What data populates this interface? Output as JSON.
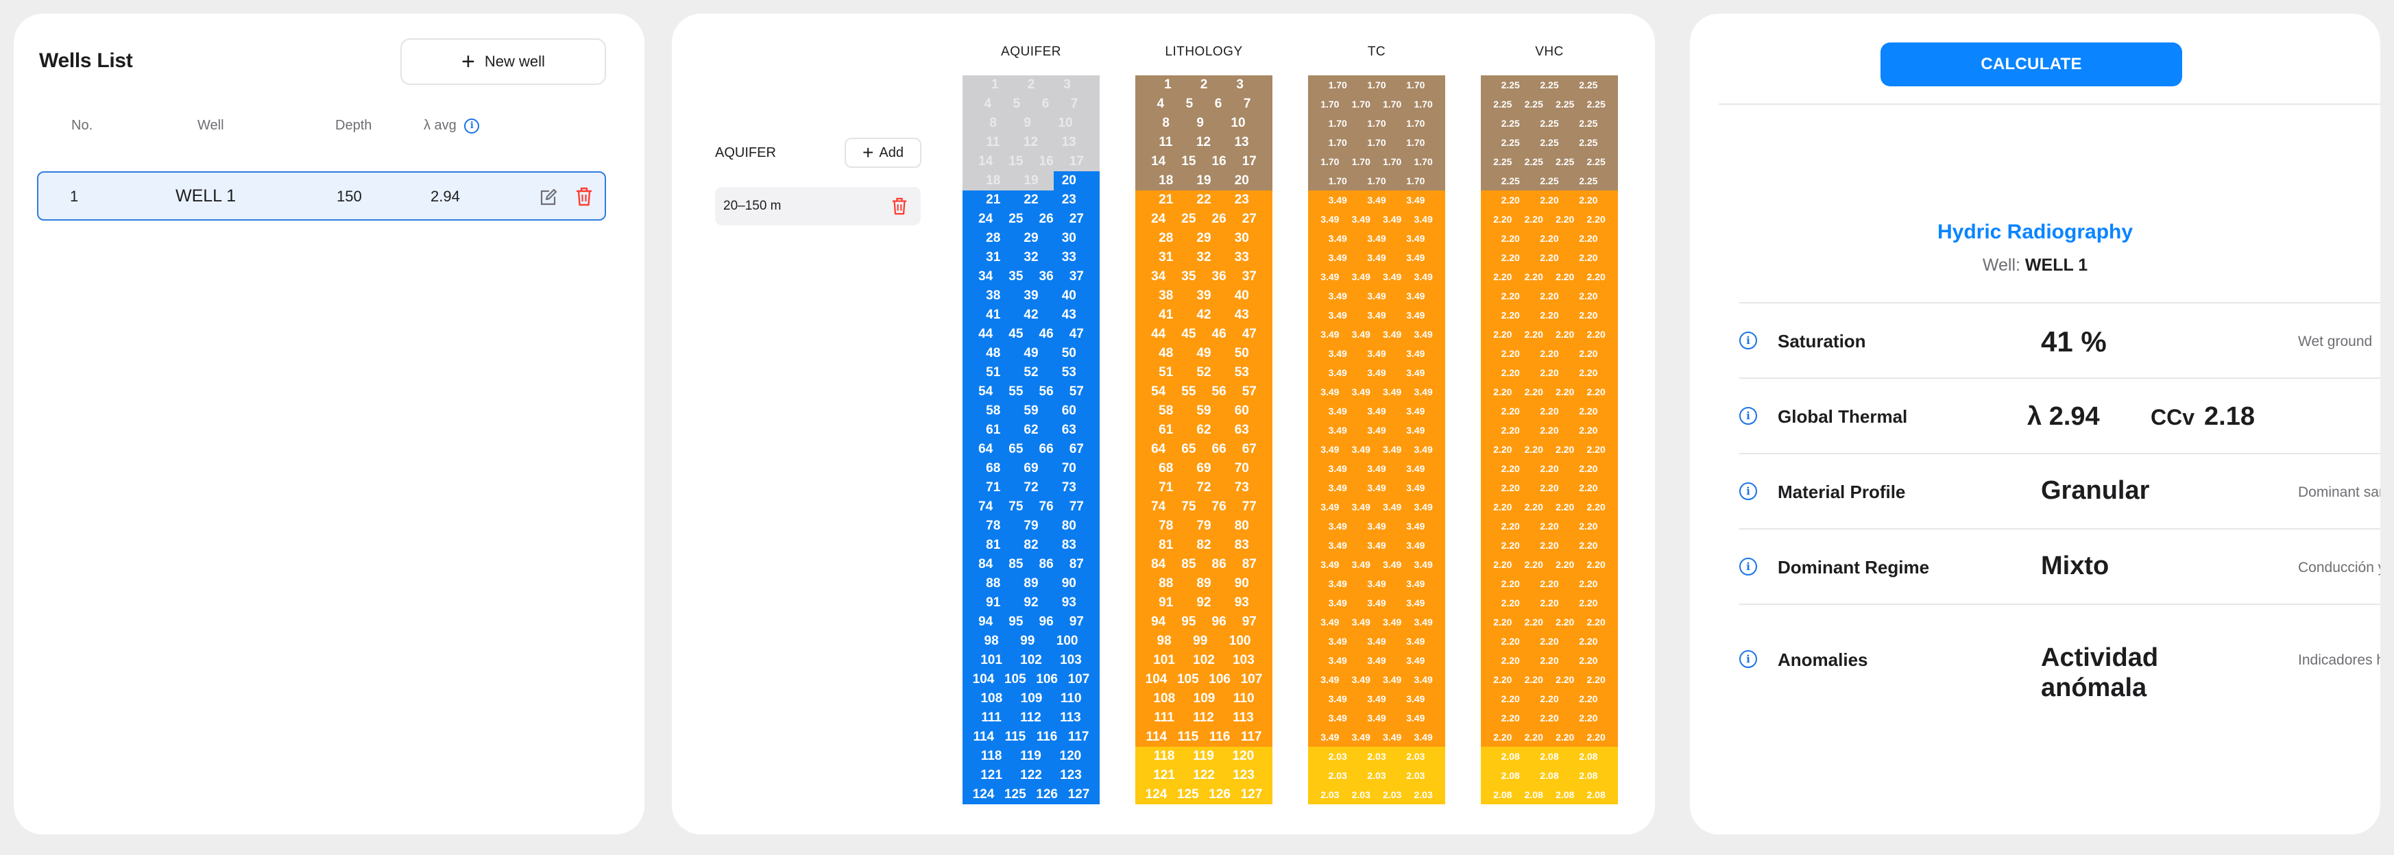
{
  "wells_list": {
    "title": "Wells List",
    "new_well_label": "New well",
    "columns": {
      "no": "No.",
      "well": "Well",
      "depth": "Depth",
      "lambda_avg": "λ avg"
    },
    "rows": [
      {
        "no": "1",
        "well": "WELL 1",
        "depth": "150",
        "lambda_avg": "2.94"
      }
    ]
  },
  "aquifer_editor": {
    "label": "AQUIFER",
    "add_label": "Add",
    "ranges": [
      "20–150 m"
    ]
  },
  "columns": {
    "aquifer": "AQUIFER",
    "lithology": "LITHOLOGY",
    "tc": "TC",
    "vhc": "VHC"
  },
  "colors": {
    "aquifer_blue": "#0a7cf0",
    "inactive_gray": "#cfcfd2",
    "lithology_brown": "#a88865",
    "lithology_orange": "#ff9a0d",
    "lithology_yellow": "#ffc90f",
    "accent": "#0a84ff",
    "danger": "#ff3b30"
  },
  "result": {
    "calculate_label": "CALCULATE",
    "title": "Hydric Radiography",
    "well_label": "Well:",
    "well_name": "WELL 1",
    "rows": [
      {
        "label": "Saturation",
        "value": "41 %",
        "note": "Wet ground"
      },
      {
        "label": "Global Thermal",
        "value": "λ 2.94",
        "value2_prefix": "CCv",
        "value2": "2.18"
      },
      {
        "label": "Material Profile",
        "value": "Granular",
        "note": "Dominant sar"
      },
      {
        "label": "Dominant Regime",
        "value": "Mixto",
        "note": "Conducción y"
      },
      {
        "label": "Anomalies",
        "value": "Actividad anómala",
        "note": "Indicadores h"
      }
    ]
  }
}
